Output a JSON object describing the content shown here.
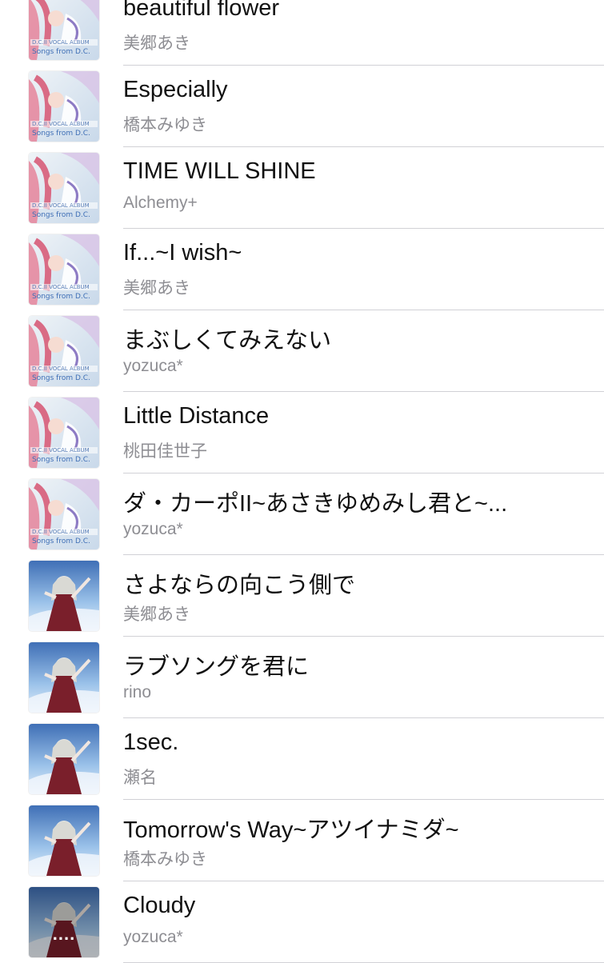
{
  "songs": [
    {
      "title": "beautiful flower",
      "artist": "美郷あき",
      "artwork": "album-art-dc2-vocal"
    },
    {
      "title": "Especially",
      "artist": "橋本みゆき",
      "artwork": "album-art-dc2-vocal"
    },
    {
      "title": "TIME WILL SHINE",
      "artist": "Alchemy+",
      "artwork": "album-art-dc2-vocal"
    },
    {
      "title": "If...~I wish~",
      "artist": "美郷あき",
      "artwork": "album-art-dc2-vocal"
    },
    {
      "title": "まぶしくてみえない",
      "artist": "yozuca*",
      "artwork": "album-art-dc2-vocal"
    },
    {
      "title": "Little Distance",
      "artist": "桃田佳世子",
      "artwork": "album-art-dc2-vocal"
    },
    {
      "title": "ダ・カーポII~あさきゆめみし君と~...",
      "artist": "yozuca*",
      "artwork": "album-art-dc2-vocal"
    },
    {
      "title": "さよならの向こう側で",
      "artist": "美郷あき",
      "artwork": "album-art-sky"
    },
    {
      "title": "ラブソングを君に",
      "artist": "rino",
      "artwork": "album-art-sky"
    },
    {
      "title": "1sec.",
      "artist": "瀬名",
      "artwork": "album-art-sky"
    },
    {
      "title": "Tomorrow's Way~アツイナミダ~",
      "artist": "橋本みゆき",
      "artwork": "album-art-sky"
    },
    {
      "title": "Cloudy",
      "artist": "yozuca*",
      "artwork": "album-art-sky",
      "now_playing": true,
      "playing_indicator": "...."
    }
  ]
}
